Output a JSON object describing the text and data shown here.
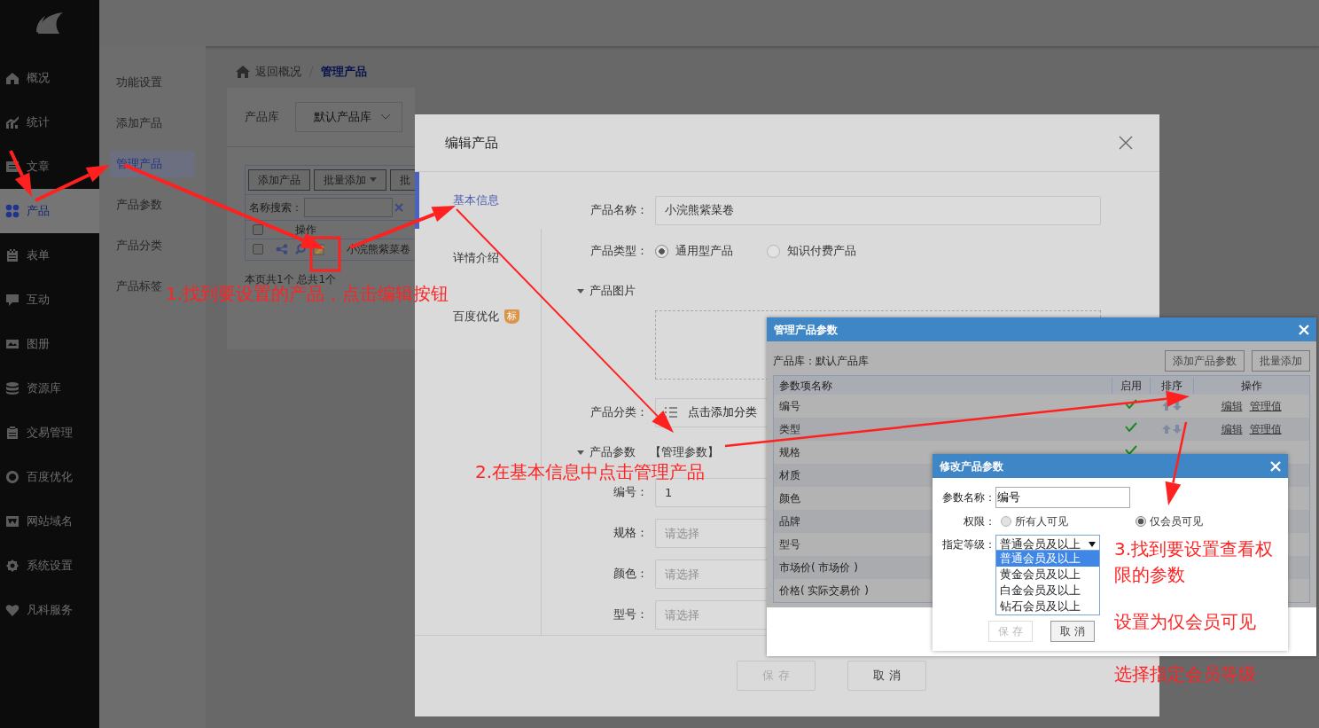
{
  "sidebar": {
    "items": [
      {
        "label": "概况",
        "selected": false
      },
      {
        "label": "统计",
        "selected": false
      },
      {
        "label": "文章",
        "selected": false
      },
      {
        "label": "产品",
        "selected": true
      },
      {
        "label": "表单",
        "selected": false
      },
      {
        "label": "互动",
        "selected": false
      },
      {
        "label": "图册",
        "selected": false
      },
      {
        "label": "资源库",
        "selected": false
      },
      {
        "label": "交易管理",
        "selected": false
      },
      {
        "label": "百度优化",
        "selected": false
      },
      {
        "label": "网站域名",
        "selected": false
      },
      {
        "label": "系统设置",
        "selected": false
      },
      {
        "label": "凡科服务",
        "selected": false
      }
    ]
  },
  "subnav": {
    "items": [
      {
        "label": "功能设置",
        "selected": false
      },
      {
        "label": "添加产品",
        "selected": false
      },
      {
        "label": "管理产品",
        "selected": true
      },
      {
        "label": "产品参数",
        "selected": false
      },
      {
        "label": "产品分类",
        "selected": false
      },
      {
        "label": "产品标签",
        "selected": false
      }
    ]
  },
  "breadcrumb": [
    {
      "label": "返回概况",
      "current": false
    },
    {
      "label": "管理产品",
      "current": true
    }
  ],
  "library": {
    "label": "产品库",
    "value": "默认产品库"
  },
  "product_table": {
    "buttons": [
      {
        "label": "添加产品",
        "dropdown": false
      },
      {
        "label": "批量添加",
        "dropdown": true
      },
      {
        "label": "批",
        "dropdown": false
      }
    ],
    "search_label": "名称搜索：",
    "select_all": {
      "checked": false
    },
    "columns": [
      "操作"
    ],
    "rows": [
      {
        "name": "小浣熊紫菜卷",
        "checked": false
      }
    ],
    "footer": "本页共1个 总共1个"
  },
  "edit_modal": {
    "title": "编辑产品",
    "tabs": [
      {
        "label": "基本信息",
        "selected": true
      },
      {
        "label": "详情介绍",
        "selected": false
      },
      {
        "label": "百度优化",
        "selected": false,
        "badge": "标"
      }
    ],
    "fields": [
      {
        "kind": "input",
        "label": "产品名称：",
        "value": "小浣熊紫菜卷"
      },
      {
        "kind": "radio",
        "label": "产品类型：",
        "options": [
          {
            "label": "通用型产品",
            "selected": true
          },
          {
            "label": "知识付费产品",
            "selected": false
          }
        ]
      },
      {
        "kind": "section",
        "label": "产品图片"
      },
      {
        "kind": "upload"
      },
      {
        "kind": "category",
        "label": "产品分类：",
        "button": "点击添加分类"
      },
      {
        "kind": "section",
        "label": "产品参数",
        "link": "【管理参数】"
      },
      {
        "kind": "input",
        "label": "编号：",
        "value": "1"
      },
      {
        "kind": "input",
        "label": "规格：",
        "placeholder": "请选择"
      },
      {
        "kind": "input",
        "label": "颜色：",
        "placeholder": "请选择"
      },
      {
        "kind": "input",
        "label": "型号：",
        "placeholder": "请选择"
      }
    ],
    "buttons": [
      {
        "label": "保 存",
        "disabled": true
      },
      {
        "label": "取 消",
        "disabled": false
      }
    ]
  },
  "params_dialog": {
    "title": "管理产品参数",
    "library": "产品库：默认产品库",
    "buttons": [
      "添加产品参数",
      "批量添加"
    ],
    "columns": [
      "参数项名称",
      "启用",
      "排序",
      "操作"
    ],
    "rows": [
      {
        "name": "编号",
        "enabled": true,
        "sortable": true,
        "actions": [
          "编辑",
          "管理值"
        ]
      },
      {
        "name": "类型",
        "enabled": true,
        "sortable": true,
        "actions": [
          "编辑",
          "管理值"
        ]
      },
      {
        "name": "规格",
        "enabled": true
      },
      {
        "name": "材质"
      },
      {
        "name": "颜色"
      },
      {
        "name": "品牌"
      },
      {
        "name": "型号"
      },
      {
        "name": "市场价( 市场价 )"
      },
      {
        "name": "价格( 实际交易价 )"
      }
    ]
  },
  "param_edit_dialog": {
    "title": "修改产品参数",
    "name_label": "参数名称：",
    "name_value": "编号",
    "permission_label": "权限：",
    "permission_options": [
      {
        "label": "所有人可见",
        "selected": false
      },
      {
        "label": "仅会员可见",
        "selected": true
      }
    ],
    "level_label": "指定等级：",
    "level_value": "普通会员及以上",
    "level_options": [
      {
        "label": "普通会员及以上",
        "selected": true
      },
      {
        "label": "黄金会员及以上",
        "selected": false
      },
      {
        "label": "白金会员及以上",
        "selected": false
      },
      {
        "label": "钻石会员及以上",
        "selected": false
      }
    ],
    "buttons": [
      {
        "label": "保 存",
        "disabled": true
      },
      {
        "label": "取 消",
        "disabled": false
      }
    ]
  },
  "annotations": [
    {
      "text": "1.找到要设置的产品，点击编辑按钮"
    },
    {
      "text": "2.在基本信息中点击管理产品"
    },
    {
      "text": "3.找到要设置查看权限的参数"
    },
    {
      "text": "设置为仅会员可见"
    },
    {
      "text": "选择指定会员等级"
    }
  ]
}
